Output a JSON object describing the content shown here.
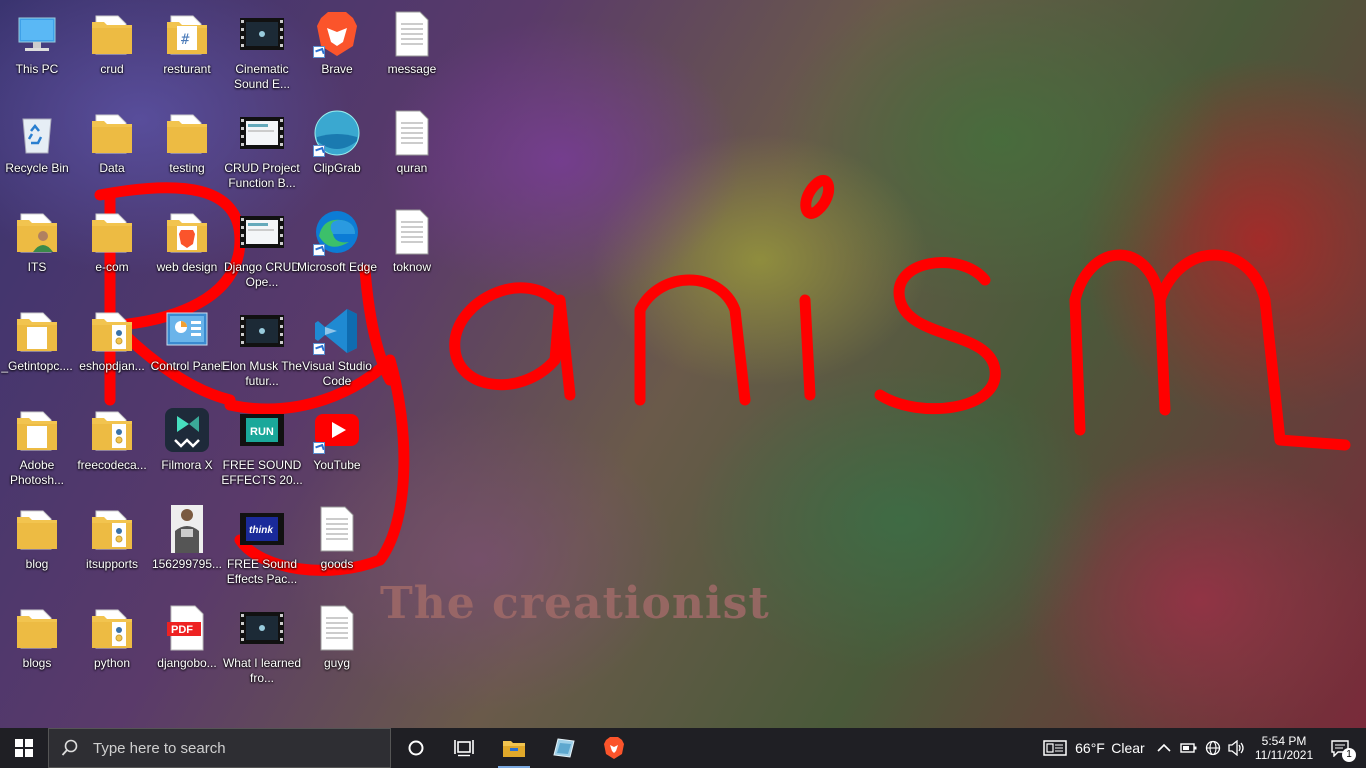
{
  "desktop": {
    "icons": [
      {
        "id": "this-pc",
        "label": "This PC",
        "type": "pc"
      },
      {
        "id": "recycle-bin",
        "label": "Recycle Bin",
        "type": "recycle"
      },
      {
        "id": "its",
        "label": "ITS",
        "type": "folder-user"
      },
      {
        "id": "getintopc",
        "label": "_Getintopc....",
        "type": "folder-doc"
      },
      {
        "id": "adobe-photoshop",
        "label": "Adobe Photosh...",
        "type": "folder-doc"
      },
      {
        "id": "blog",
        "label": "blog",
        "type": "folder"
      },
      {
        "id": "blogs",
        "label": "blogs",
        "type": "folder"
      },
      {
        "id": "crud",
        "label": "crud",
        "type": "folder"
      },
      {
        "id": "data",
        "label": "Data",
        "type": "folder"
      },
      {
        "id": "e-com",
        "label": "e-com",
        "type": "folder"
      },
      {
        "id": "eshopdjango",
        "label": "eshopdjan...",
        "type": "folder-py"
      },
      {
        "id": "freecodecamp",
        "label": "freecodeca...",
        "type": "folder-py"
      },
      {
        "id": "itsupports",
        "label": "itsupports",
        "type": "folder-py"
      },
      {
        "id": "python",
        "label": "python",
        "type": "folder-py"
      },
      {
        "id": "resturant",
        "label": "resturant",
        "type": "folder-hash"
      },
      {
        "id": "testing",
        "label": "testing",
        "type": "folder"
      },
      {
        "id": "web-design",
        "label": "web design",
        "type": "folder-brave"
      },
      {
        "id": "control-panel",
        "label": "Control Panel",
        "type": "control-panel"
      },
      {
        "id": "filmora-x",
        "label": "Filmora X",
        "type": "filmora"
      },
      {
        "id": "image-1562",
        "label": "156299795...",
        "type": "photo"
      },
      {
        "id": "djangobook",
        "label": "djangobo...",
        "type": "pdf"
      },
      {
        "id": "cinematic-sound",
        "label": "Cinematic Sound E...",
        "type": "video"
      },
      {
        "id": "crud-project",
        "label": "CRUD Project Function B...",
        "type": "video-light"
      },
      {
        "id": "django-crud",
        "label": "Django CRUD Ope...",
        "type": "video-light"
      },
      {
        "id": "elon-musk",
        "label": "Elon Musk The futur...",
        "type": "video"
      },
      {
        "id": "free-sound-effects-20",
        "label": "FREE SOUND EFFECTS 20...",
        "type": "video-run"
      },
      {
        "id": "free-sound-effects-pack",
        "label": "FREE Sound Effects Pac...",
        "type": "video-think"
      },
      {
        "id": "what-i-learned",
        "label": "What I learned fro...",
        "type": "video"
      },
      {
        "id": "brave",
        "label": "Brave",
        "type": "brave"
      },
      {
        "id": "clipgrab",
        "label": "ClipGrab",
        "type": "clipgrab"
      },
      {
        "id": "microsoft-edge",
        "label": "Microsoft Edge",
        "type": "edge"
      },
      {
        "id": "vscode",
        "label": "Visual Studio Code",
        "type": "vscode"
      },
      {
        "id": "youtube",
        "label": "YouTube",
        "type": "youtube"
      },
      {
        "id": "goods",
        "label": "goods",
        "type": "text"
      },
      {
        "id": "guyg",
        "label": "guyg",
        "type": "text"
      },
      {
        "id": "message",
        "label": "message",
        "type": "text"
      },
      {
        "id": "quran",
        "label": "quran",
        "type": "text"
      },
      {
        "id": "toknow",
        "label": "toknow",
        "type": "text"
      }
    ]
  },
  "wallpaper": {
    "caption": "The creationist",
    "scribble_color": "#ff0000"
  },
  "taskbar": {
    "search_placeholder": "Type here to search",
    "pinned": [
      "file-explorer-icon",
      "pen-tablet-icon",
      "brave-icon"
    ],
    "weather": {
      "temp": "66°F",
      "condition": "Clear"
    },
    "clock": {
      "time": "5:54 PM",
      "date": "11/11/2021"
    },
    "notification_count": "1"
  },
  "colors": {
    "taskbar_bg": "#1f1f24",
    "folder": "#f2c44f",
    "accent": "#7aa8e0"
  }
}
